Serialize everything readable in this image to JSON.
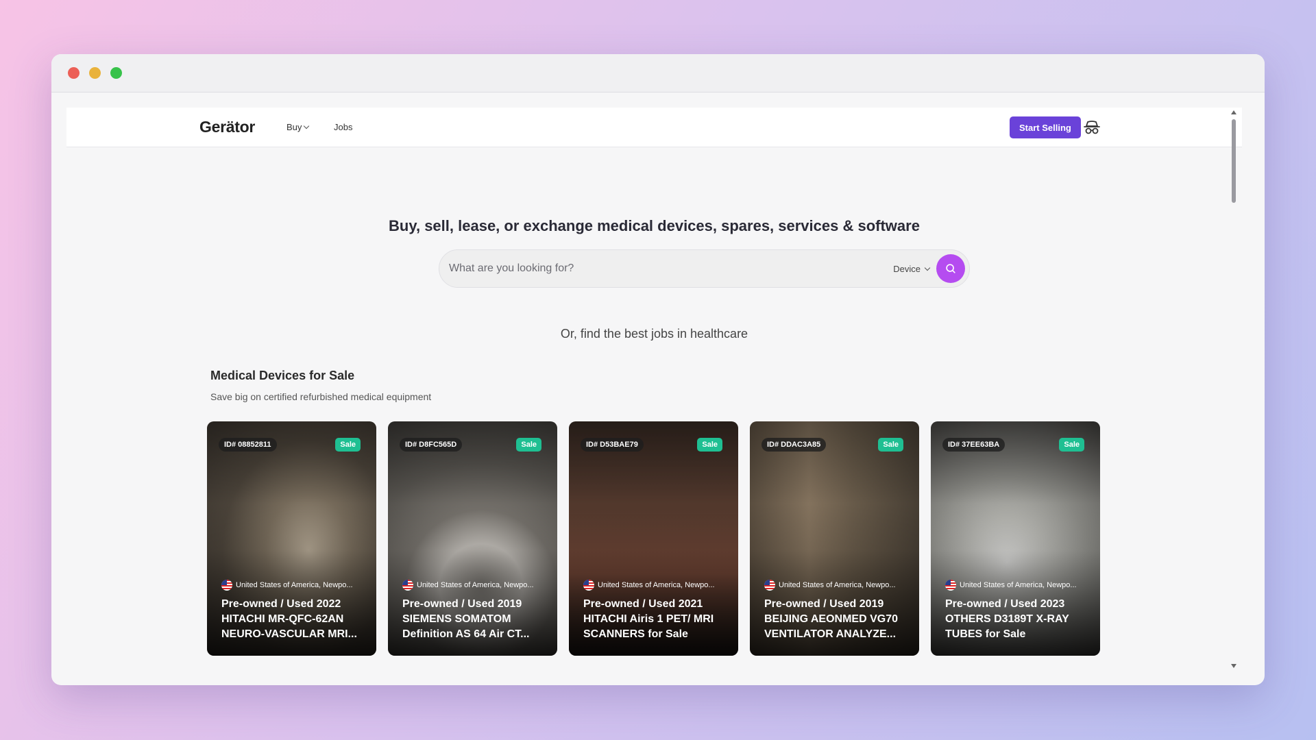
{
  "window": {
    "controls": [
      "close",
      "minimize",
      "maximize"
    ]
  },
  "navbar": {
    "logo": "Gerätor",
    "buy_label": "Buy",
    "jobs_label": "Jobs",
    "start_selling_label": "Start Selling",
    "incognito_icon": "incognito-icon",
    "accent_color": "#6a42d9"
  },
  "hero": {
    "title": "Buy, sell, lease, or exchange medical devices, spares, services & software",
    "search_placeholder": "What are you looking for?",
    "search_value": "",
    "category_selected": "Device",
    "search_button_color": "#b54cf0",
    "jobs_link": "Or, find the best jobs in healthcare"
  },
  "section": {
    "title": "Medical Devices for Sale",
    "subtitle": "Save big on certified refurbished medical equipment"
  },
  "cards": [
    {
      "id": "ID# 08852811",
      "badge": "Sale",
      "location": "United States of America, Newpo...",
      "title": "Pre-owned / Used 2022 HITACHI MR-QFC-62AN NEURO-VASCULAR MRI..."
    },
    {
      "id": "ID# D8FC565D",
      "badge": "Sale",
      "location": "United States of America, Newpo...",
      "title": "Pre-owned / Used 2019 SIEMENS SOMATOM Definition AS 64 Air CT..."
    },
    {
      "id": "ID# D53BAE79",
      "badge": "Sale",
      "location": "United States of America, Newpo...",
      "title": "Pre-owned / Used 2021 HITACHI Airis 1 PET/ MRI SCANNERS for Sale"
    },
    {
      "id": "ID# DDAC3A85",
      "badge": "Sale",
      "location": "United States of America, Newpo...",
      "title": "Pre-owned / Used 2019 BEIJING AEONMED VG70 VENTILATOR ANALYZE..."
    },
    {
      "id": "ID# 37EE63BA",
      "badge": "Sale",
      "location": "United States of America, Newpo...",
      "title": "Pre-owned / Used 2023 OTHERS D3189T X-RAY TUBES for Sale"
    }
  ],
  "colors": {
    "sale_badge": "#1fbf92"
  }
}
